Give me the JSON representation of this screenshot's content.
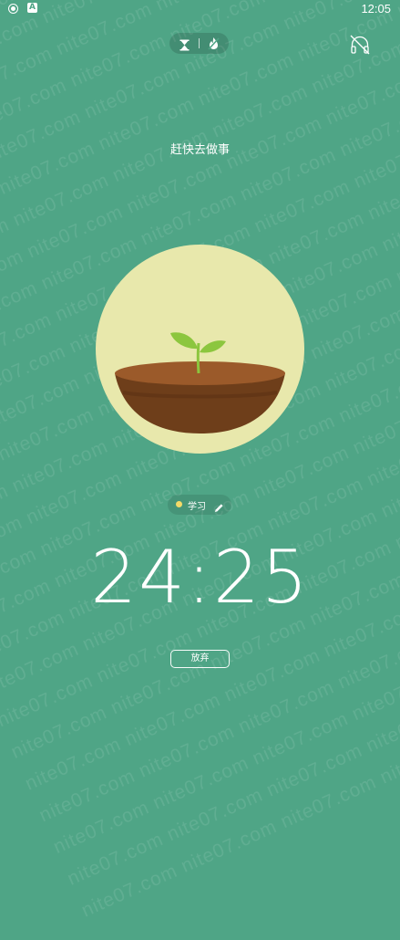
{
  "status_bar": {
    "time": "12:05",
    "left_icons": [
      "location-icon",
      "app-notification-icon"
    ],
    "app_icon_letter": "A"
  },
  "mode_switch": {
    "icons": [
      "hourglass-icon",
      "fire-icon"
    ]
  },
  "headphones": {
    "icon": "headphones-off-icon"
  },
  "motivation_text": "赶快去做事",
  "tree": {
    "stage": "sprout"
  },
  "tag": {
    "label": "学习",
    "color": "#f4da68",
    "edit_icon": "pencil-icon"
  },
  "timer": {
    "value": "24:25"
  },
  "give_up_button": {
    "label": "放弃"
  },
  "watermark": {
    "text": "nite07.com nite07.com nite07.com nite07.com nite07.com nite07.com nite07.com nite07.com nite07.com"
  },
  "colors": {
    "background": "#4fa586",
    "tree_circle": "#e8e8ac",
    "soil": "#6e3e1a",
    "sprout": "#8cc63e"
  }
}
